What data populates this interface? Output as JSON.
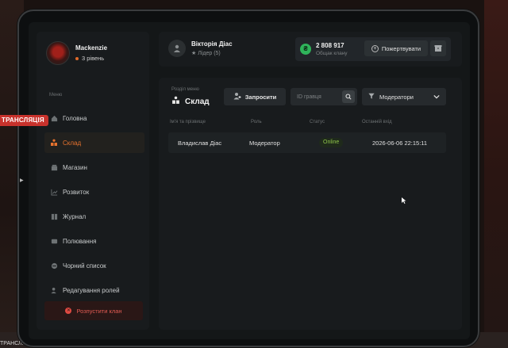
{
  "overlay": {
    "stream_tag": "ТРАНСЛЯЦІЯ",
    "stream_tag_bottom": "ТРАНСЛЯЦІЯ"
  },
  "profile": {
    "name": "Mackenzie",
    "level": "3 рівень"
  },
  "sidebar": {
    "caption": "Меню",
    "items": [
      {
        "label": "Головна",
        "icon": "home-icon"
      },
      {
        "label": "Склад",
        "icon": "storage-icon"
      },
      {
        "label": "Магазин",
        "icon": "shop-icon"
      },
      {
        "label": "Розвиток",
        "icon": "growth-chart-icon"
      },
      {
        "label": "Журнал",
        "icon": "journal-icon"
      },
      {
        "label": "Полювання",
        "icon": "hunt-icon"
      },
      {
        "label": "Чорний список",
        "icon": "blacklist-icon"
      },
      {
        "label": "Редагування ролей",
        "icon": "roles-icon"
      }
    ],
    "active_index": 1,
    "disband_label": "Розпустити клан"
  },
  "topbar": {
    "leader_name": "Вікторія Діас",
    "leader_role": "Лідер (5)",
    "fund_value": "2 808 917",
    "fund_label": "Общак клану",
    "donate_label": "Пожертвувати"
  },
  "main": {
    "section_caption": "Розділ меню",
    "section_title": "Склад",
    "invite_label": "Запросити",
    "search_placeholder": "ID гравця",
    "filter_value": "Модератори",
    "table": {
      "headers": [
        "Ім'я та прізвище",
        "Роль",
        "Статус",
        "Останній вхід"
      ],
      "rows": [
        {
          "name": "Владислав Діас",
          "role": "Модератор",
          "status": "Online",
          "last_login": "2026-06-06 22:15:11"
        }
      ]
    }
  },
  "colors": {
    "accent": "#e8732e",
    "online": "#8fc64a",
    "danger": "#e05a52",
    "fund": "#2fb35a"
  }
}
